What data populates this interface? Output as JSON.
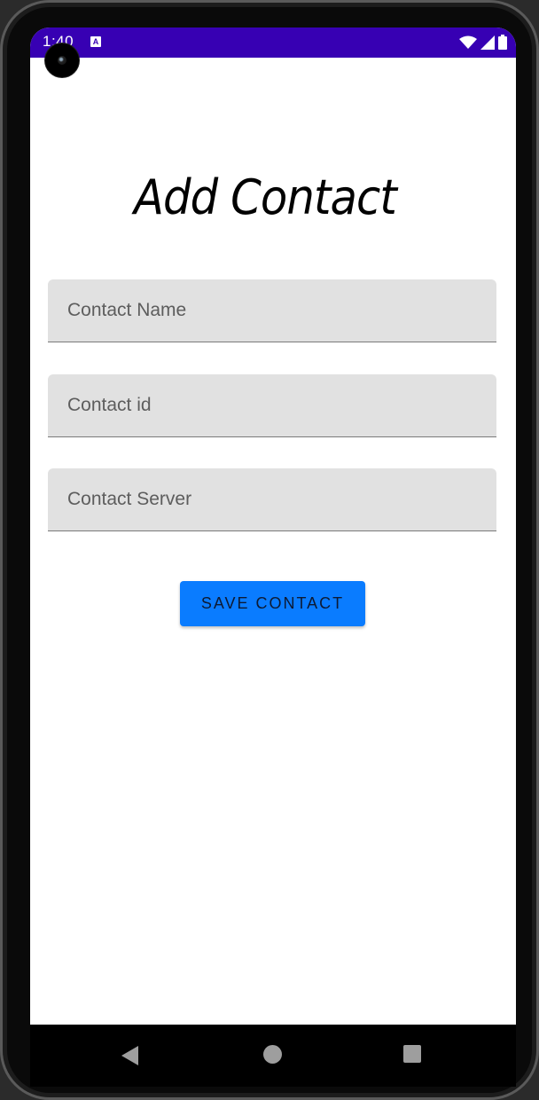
{
  "status_bar": {
    "time": "1:40",
    "notification_icon": "A",
    "icons": [
      "wifi-icon",
      "signal-icon",
      "battery-icon"
    ],
    "background_color": "#3700b3"
  },
  "page": {
    "title": "Add Contact"
  },
  "form": {
    "name_placeholder": "Contact Name",
    "id_placeholder": "Contact id",
    "server_placeholder": "Contact Server",
    "name_value": "",
    "id_value": "",
    "server_value": "",
    "field_background": "#e1e1e1"
  },
  "save_button": {
    "label": "SAVE CONTACT",
    "color": "#0a7cff"
  },
  "nav_bar": {
    "buttons": [
      "back-icon",
      "home-icon",
      "recents-icon"
    ]
  }
}
